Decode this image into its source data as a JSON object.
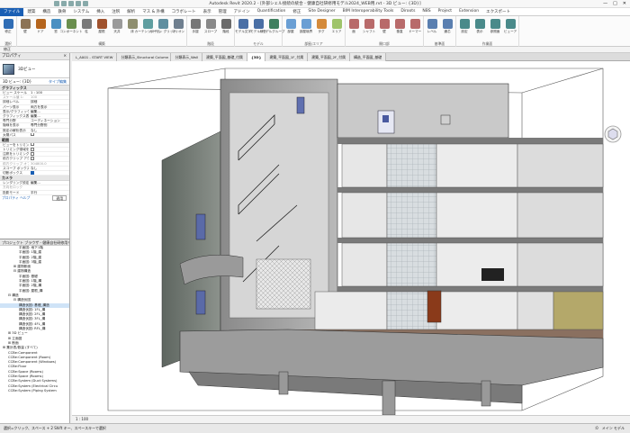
{
  "titlebar": {
    "title": "Autodesk Revit 2020.2 - [外部シェル接続の統合 - 健康自社研修用モデル2024_WEB用.rvt - 3D ビュー: {3D}]",
    "minimize": "—",
    "maximize": "□",
    "close": "✕"
  },
  "menu": {
    "file_label": "ファイル",
    "tabs": [
      "建築",
      "構造",
      "鉄骨",
      "システム",
      "挿入",
      "注釈",
      "解析",
      "マス & 外構",
      "コラボレート",
      "表示",
      "管理",
      "アドイン",
      "Quantification",
      "修正",
      "Site Designer",
      "BIM Interoperability Tools",
      "Diroots",
      "NBS",
      "Project",
      "Extension",
      "エクスポート"
    ]
  },
  "ribbon": {
    "groups": [
      {
        "name": "選択",
        "buttons": [
          {
            "label": "修正",
            "icon": "cursor-icon",
            "color": "#2f6db5"
          }
        ]
      },
      {
        "name": "構築",
        "buttons": [
          {
            "label": "壁",
            "icon": "wall-icon",
            "color": "#8c7355"
          },
          {
            "label": "ドア",
            "icon": "door-icon",
            "color": "#b5651d"
          },
          {
            "label": "窓",
            "icon": "window-icon",
            "color": "#4a90c2"
          },
          {
            "label": "コンポーネント",
            "icon": "component-icon",
            "color": "#6a8f4e"
          },
          {
            "label": "柱",
            "icon": "column-icon",
            "color": "#7a7a7a"
          },
          {
            "label": "屋根",
            "icon": "roof-icon",
            "color": "#a0522d"
          },
          {
            "label": "天井",
            "icon": "ceiling-icon",
            "color": "#9a9a9a"
          },
          {
            "label": "床",
            "icon": "floor-icon",
            "color": "#8f8f6f"
          },
          {
            "label": "カーテンシステム",
            "icon": "curtain-system-icon",
            "color": "#5f9ea0"
          },
          {
            "label": "カーテン グリッド",
            "icon": "curtain-grid-icon",
            "color": "#5f8fa0"
          },
          {
            "label": "マリオン",
            "icon": "mullion-icon",
            "color": "#6f7f8f"
          }
        ]
      },
      {
        "name": "階段",
        "buttons": [
          {
            "label": "手摺",
            "icon": "railing-icon",
            "color": "#777"
          },
          {
            "label": "スロープ",
            "icon": "ramp-icon",
            "color": "#888"
          },
          {
            "label": "階段",
            "icon": "stair-icon",
            "color": "#6a6a6a"
          }
        ]
      },
      {
        "name": "モデル",
        "buttons": [
          {
            "label": "モデル文字",
            "icon": "model-text-icon",
            "color": "#4a6fa5"
          },
          {
            "label": "モデル線分",
            "icon": "model-line-icon",
            "color": "#4a6fa5"
          },
          {
            "label": "モデルグループ",
            "icon": "model-group-icon",
            "color": "#3f7f5f"
          }
        ]
      },
      {
        "name": "部屋/エリア",
        "buttons": [
          {
            "label": "部屋",
            "icon": "room-icon",
            "color": "#6a9fd4"
          },
          {
            "label": "部屋境界",
            "icon": "room-separator-icon",
            "color": "#6a9fd4"
          },
          {
            "label": "タグ",
            "icon": "tag-icon",
            "color": "#d48a3a"
          },
          {
            "label": "エリア",
            "icon": "area-icon",
            "color": "#9fc46a"
          }
        ]
      },
      {
        "name": "開口部",
        "buttons": [
          {
            "label": "面",
            "icon": "by-face-icon",
            "color": "#b86a6a"
          },
          {
            "label": "シャフト",
            "icon": "shaft-icon",
            "color": "#b86a6a"
          },
          {
            "label": "壁",
            "icon": "wall-opening-icon",
            "color": "#b86a6a"
          },
          {
            "label": "垂直",
            "icon": "vertical-opening-icon",
            "color": "#b86a6a"
          },
          {
            "label": "ドーマー",
            "icon": "dormer-icon",
            "color": "#b86a6a"
          }
        ]
      },
      {
        "name": "基準面",
        "buttons": [
          {
            "label": "レベル",
            "icon": "level-icon",
            "color": "#5a7fb0"
          },
          {
            "label": "通芯",
            "icon": "grid-icon",
            "color": "#5a7fb0"
          }
        ]
      },
      {
        "name": "作業面",
        "buttons": [
          {
            "label": "設定",
            "icon": "set-workplane-icon",
            "color": "#4a8a8a"
          },
          {
            "label": "表示",
            "icon": "show-workplane-icon",
            "color": "#4a8a8a"
          },
          {
            "label": "参照面",
            "icon": "ref-plane-icon",
            "color": "#4a8a8a"
          },
          {
            "label": "ビューア",
            "icon": "viewer-icon",
            "color": "#4a8a8a"
          }
        ]
      }
    ]
  },
  "selectbar": {
    "label": "修正"
  },
  "properties": {
    "header": "プロパティ",
    "close": "×",
    "type_name": "3Dビュー",
    "filter_label": "3D ビュー: {3D}",
    "edit_type": "タイプ編集",
    "sections": [
      {
        "title": "グラフィックス",
        "rows": [
          {
            "k": "ビュー スケール",
            "v": "1 : 100"
          },
          {
            "k": "スケール値 1:",
            "v": "100",
            "dim": true
          },
          {
            "k": "詳細レベル",
            "v": "詳細"
          },
          {
            "k": "パーツ表示",
            "v": "両方を表示"
          },
          {
            "k": "表示/グラフィックス",
            "v": "編集..."
          },
          {
            "k": "グラフィックス表示",
            "v": "編集..."
          },
          {
            "k": "専門分野",
            "v": "コーディネーション"
          },
          {
            "k": "隠線を表示",
            "v": "専門分野別"
          },
          {
            "k": "既定の解析表示",
            "v": "なし"
          },
          {
            "k": "太陽パス",
            "v": "",
            "check": false
          }
        ]
      },
      {
        "title": "範囲",
        "rows": [
          {
            "k": "ビューをトリミング",
            "v": "",
            "check": false
          },
          {
            "k": "トリミング領域を表示",
            "v": "",
            "check": false
          },
          {
            "k": "注釈をトリミング",
            "v": "",
            "check": false
          },
          {
            "k": "前方クリップ アクティブ",
            "v": "",
            "check": false
          },
          {
            "k": "前方クリップ オフセット",
            "v": "304800.0",
            "dim": true
          },
          {
            "k": "スコープ ボックス",
            "v": "なし"
          },
          {
            "k": "切断ボックス",
            "v": "",
            "check": true
          }
        ]
      },
      {
        "title": "カメラ",
        "rows": [
          {
            "k": "レンダリング設定",
            "v": "編集..."
          },
          {
            "k": "方向をロック",
            "v": "",
            "dim": true
          },
          {
            "k": "投影モード",
            "v": "平行"
          }
        ]
      }
    ],
    "help_link": "プロパティ ヘルプ",
    "apply": "適用"
  },
  "browser": {
    "header": "プロジェクト ブラウザ - 健康自社研修用モデル",
    "items": [
      {
        "text": "平面図: 地下1階",
        "indent": 3
      },
      {
        "text": "平面図: 1階_建",
        "indent": 3
      },
      {
        "text": "平面図: 2階_建",
        "indent": 3
      },
      {
        "text": "平面図: 3階_建",
        "indent": 3
      },
      {
        "text": "⊞ 建物断面",
        "indent": 2
      },
      {
        "text": "⊟ 建物構造",
        "indent": 2
      },
      {
        "text": "平面図: 基礎",
        "indent": 3
      },
      {
        "text": "平面図: 1階_構",
        "indent": 3
      },
      {
        "text": "平面図: 2階_構",
        "indent": 3
      },
      {
        "text": "平面図: 屋根_構",
        "indent": 3
      },
      {
        "text": "⊟ 構造",
        "indent": 1
      },
      {
        "text": "⊟ 構造伏図",
        "indent": 2
      },
      {
        "text": "構造伏図: 基礎_構造",
        "indent": 3,
        "sel": true
      },
      {
        "text": "構造伏図: 1FL_構",
        "indent": 3
      },
      {
        "text": "構造伏図: 2FL_構",
        "indent": 3
      },
      {
        "text": "構造伏図: 3FL_構",
        "indent": 3
      },
      {
        "text": "構造伏図: 4FL_構",
        "indent": 3
      },
      {
        "text": "構造伏図: RFL_構",
        "indent": 3
      },
      {
        "text": "⊞ 3D ビュー",
        "indent": 1
      },
      {
        "text": "⊞ 立面図",
        "indent": 1
      },
      {
        "text": "⊞ 断面",
        "indent": 1
      },
      {
        "text": "⊞ 集計表/数量 (すべて)",
        "indent": 0
      },
      {
        "text": "CCBe:Component",
        "indent": 1
      },
      {
        "text": "CCBe:Component (Room)",
        "indent": 1
      },
      {
        "text": "CCBe:Component (Windows)",
        "indent": 1
      },
      {
        "text": "CCBe:Floor",
        "indent": 1
      },
      {
        "text": "CCBe:Space (Rooms)",
        "indent": 1
      },
      {
        "text": "CCBe:Space (Rooms)",
        "indent": 1
      },
      {
        "text": "CCBe:System (Duct Systems)",
        "indent": 1
      },
      {
        "text": "CCBe:System (Electrical Circu",
        "indent": 1
      },
      {
        "text": "CCBe:System (Piping System",
        "indent": 1
      }
    ]
  },
  "view_tabs": [
    {
      "label": "L_A001 - START VIEW"
    },
    {
      "label": "分類表示_Structural Column"
    },
    {
      "label": "分類表示_Wall"
    },
    {
      "label": "建築_平面図_基礎_付属"
    },
    {
      "label": "{3D}",
      "active": true
    },
    {
      "label": "建築_平面図_1F_付属"
    },
    {
      "label": "建築_平面図_2F_付属"
    },
    {
      "label": "構造_平面図_基礎"
    }
  ],
  "view_control": {
    "scale": "1 : 100"
  },
  "status": {
    "text": "選択=クリック、スペース + 2 Shift キー、スペースキーで選択",
    "zero": ":0",
    "model": "メイン モデル"
  }
}
